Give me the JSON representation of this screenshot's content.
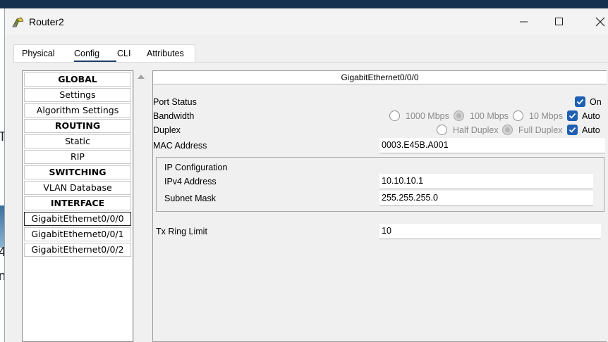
{
  "window": {
    "title": "Router2"
  },
  "tabs": [
    {
      "label": "Physical"
    },
    {
      "label": "Config"
    },
    {
      "label": "CLI"
    },
    {
      "label": "Attributes"
    }
  ],
  "nav": {
    "items": [
      {
        "label": "GLOBAL"
      },
      {
        "label": "Settings"
      },
      {
        "label": "Algorithm Settings"
      },
      {
        "label": "ROUTING"
      },
      {
        "label": "Static"
      },
      {
        "label": "RIP"
      },
      {
        "label": "SWITCHING"
      },
      {
        "label": "VLAN Database"
      },
      {
        "label": "INTERFACE"
      },
      {
        "label": "GigabitEthernet0/0/0"
      },
      {
        "label": "GigabitEthernet0/0/1"
      },
      {
        "label": "GigabitEthernet0/0/2"
      }
    ],
    "selected": "GigabitEthernet0/0/0"
  },
  "panel": {
    "title": "GigabitEthernet0/0/0",
    "port_status": {
      "label": "Port Status",
      "on_label": "On",
      "on_checked": true
    },
    "bandwidth": {
      "label": "Bandwidth",
      "options": [
        "1000 Mbps",
        "100 Mbps",
        "10 Mbps"
      ],
      "selected": "100 Mbps",
      "auto_label": "Auto",
      "auto_checked": true
    },
    "duplex": {
      "label": "Duplex",
      "options": [
        "Half Duplex",
        "Full Duplex"
      ],
      "selected": "Full Duplex",
      "auto_label": "Auto",
      "auto_checked": true
    },
    "mac": {
      "label": "MAC Address",
      "value": "0003.E45B.A001"
    },
    "ip_config": {
      "title": "IP Configuration",
      "ipv4_label": "IPv4 Address",
      "ipv4_value": "10.10.10.1",
      "mask_label": "Subnet Mask",
      "mask_value": "255.255.255.0"
    },
    "tx_ring": {
      "label": "Tx Ring Limit",
      "value": "10"
    }
  },
  "background_fragments": [
    "T",
    "4",
    "n"
  ],
  "colors": {
    "accent": "#1f5fb3",
    "tab_underline": "#1a3f6e"
  }
}
